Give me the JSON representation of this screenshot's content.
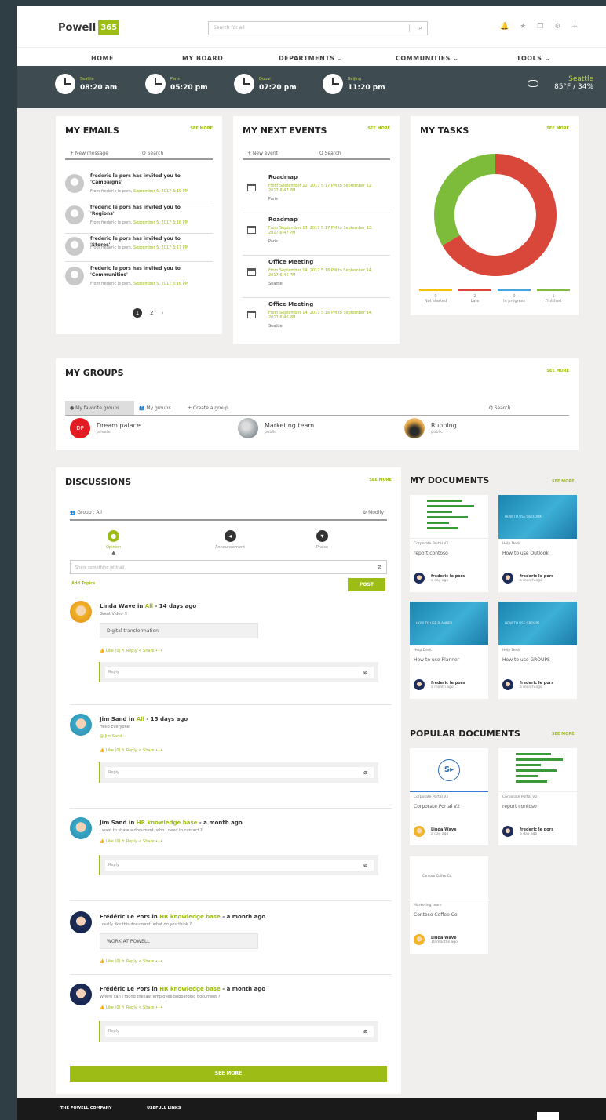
{
  "header": {
    "logo_text": "Powell",
    "logo_badge": "365",
    "search_placeholder": "Search for all",
    "icons": [
      "bell-icon",
      "star-icon",
      "copy-icon",
      "gear-icon",
      "plus-icon"
    ]
  },
  "nav": [
    "HOME",
    "MY BOARD",
    "DEPARTMENTS ⌄",
    "COMMUNITIES ⌄",
    "TOOLS ⌄"
  ],
  "clocks": [
    {
      "city": "Seattle",
      "time": "08:20 am"
    },
    {
      "city": "Paris",
      "time": "05:20 pm"
    },
    {
      "city": "Dubai",
      "time": "07:20 pm"
    },
    {
      "city": "Beijing",
      "time": "11:20 pm"
    }
  ],
  "weather": {
    "city": "Seattle",
    "temp": "85°F / 34%"
  },
  "emails": {
    "title": "MY EMAILS",
    "see_more": "SEE MORE",
    "new_label": "+ New message",
    "search_label": "Q  Search",
    "items": [
      {
        "subject": "frederic le pors has invited you to 'Campaigns'",
        "from": "From frederic le pors,",
        "date": "September 5, 2017 3:19 PM"
      },
      {
        "subject": "frederic le pors has invited you to 'Regions'",
        "from": "From frederic le pors,",
        "date": "September 5, 2017 3:18 PM"
      },
      {
        "subject": "frederic le pors has invited you to 'Stores'",
        "from": "From frederic le pors,",
        "date": "September 5, 2017 3:17 PM"
      },
      {
        "subject": "frederic le pors has invited you to 'Communities'",
        "from": "From frederic le pors,",
        "date": "September 5, 2017 3:16 PM"
      }
    ],
    "pages": [
      "1",
      "2",
      "›"
    ]
  },
  "events": {
    "title": "MY NEXT EVENTS",
    "see_more": "SEE MORE",
    "new_label": "+ New event",
    "search_label": "Q  Search",
    "items": [
      {
        "title": "Roadmap",
        "date": "From September 12, 2017 5:17 PM to September 12, 2017 6:47 PM",
        "location": "Paris"
      },
      {
        "title": "Roadmap",
        "date": "From September 13, 2017 5:17 PM to September 13, 2017 6:47 PM",
        "location": "Paris"
      },
      {
        "title": "Office Meeting",
        "date": "From September 14, 2017 5:16 PM to September 14, 2017 6:46 PM",
        "location": "Seattle"
      },
      {
        "title": "Office Meeting",
        "date": "From September 14, 2017 5:16 PM to September 14, 2017 6:46 PM",
        "location": "Seattle"
      }
    ]
  },
  "tasks": {
    "title": "MY TASKS",
    "see_more": "SEE MORE",
    "legend": [
      {
        "label": "Not started",
        "count": "0",
        "color": "#f2c200"
      },
      {
        "label": "Late",
        "count": "2",
        "color": "#d9463a"
      },
      {
        "label": "In progress",
        "count": "0",
        "color": "#3fa8e0"
      },
      {
        "label": "Finished",
        "count": "1",
        "color": "#7dbb3a"
      }
    ]
  },
  "groups": {
    "title": "MY GROUPS",
    "see_more": "SEE MORE",
    "tabs": [
      "● My favorite groups",
      "👥  My groups",
      "+  Create a group"
    ],
    "search_label": "Q  Search",
    "items": [
      {
        "name": "Dream palace",
        "privacy": "private",
        "initials": "DP",
        "color": "#e31b23"
      },
      {
        "name": "Marketing team",
        "privacy": "public",
        "initials": "",
        "color": "#9aa3a8"
      },
      {
        "name": "Running",
        "privacy": "public",
        "initials": "",
        "color": "#d9862a"
      }
    ]
  },
  "discussions": {
    "title": "DISCUSSIONS",
    "see_more": "SEE MORE",
    "group_label": "👥  Group : All",
    "modify_label": "⚙ Modify",
    "types": [
      {
        "label": "Opinion",
        "active": true
      },
      {
        "label": "Announcement",
        "active": false
      },
      {
        "label": "Praise",
        "active": false
      }
    ],
    "share_placeholder": "Share something with all",
    "add_topics": "Add Topics",
    "post_button": "POST",
    "posts": [
      {
        "author": "Linda Wave",
        "in_word": " in ",
        "group": "All",
        "ago": " - 14 days ago",
        "body": "Great Video !!",
        "quote": "Digital transformation",
        "actions": "👍 Like (0)    ↰ Reply    < Share    •••",
        "reply": "Reply"
      },
      {
        "author": "Jim Sand",
        "in_word": " in ",
        "group": "All",
        "ago": " - 15 days ago",
        "body": "Hello Everyone!",
        "quote": "",
        "mention": "@ Jim Sand",
        "actions": "👍 Like (0)    ↰ Reply    < Share    •••",
        "reply": "Reply"
      },
      {
        "author": "Jim Sand",
        "in_word": " in ",
        "group": "HR knowledge base",
        "ago": " - a month ago",
        "body": "I want to share a document, who I need to contact ?",
        "quote": "",
        "actions": "👍 Like (0)    ↰ Reply    < Share    •••",
        "reply": "Reply"
      },
      {
        "author": "Frédéric Le Pors",
        "in_word": " in ",
        "group": "HR knowledge base",
        "ago": " - a month ago",
        "body": "I really like this document, what do you think ?",
        "quote": "WORK AT POWELL",
        "actions": "👍 Like (0)    ↰ Reply    < Share    •••",
        "reply": ""
      },
      {
        "author": "Frédéric Le Pors",
        "in_word": " in ",
        "group": "HR knowledge base",
        "ago": " - a month ago",
        "body": "Where can I found the last employee onboarding document ?",
        "quote": "",
        "actions": "👍 Like (0)    ↰ Reply    < Share    •••",
        "reply": "Reply"
      }
    ],
    "see_more_button": "SEE MORE"
  },
  "my_documents": {
    "title": "MY DOCUMENTS",
    "see_more": "SEE MORE",
    "items": [
      {
        "library": "Corporate Portal V2",
        "name": "report contoso",
        "author": "frederic le pors",
        "ago": "a day ago",
        "thumb": "chart"
      },
      {
        "library": "Help Desk",
        "name": "How to use Outlook",
        "author": "frederic le pors",
        "ago": "a month ago",
        "thumb": "blue",
        "thumb_text": "HOW TO USE OUTLOOK"
      },
      {
        "library": "Help Desk",
        "name": "How to use Planner",
        "author": "frederic le pors",
        "ago": "a month ago",
        "thumb": "blue",
        "thumb_text": "HOW TO USE PLANNER"
      },
      {
        "library": "Help Desk",
        "name": "How to use GROUPS",
        "author": "frederic le pors",
        "ago": "a month ago",
        "thumb": "blue",
        "thumb_text": "HOW TO USE GROUPS"
      }
    ]
  },
  "popular_documents": {
    "title": "POPULAR DOCUMENTS",
    "see_more": "SEE MORE",
    "items": [
      {
        "library": "Corporate Portal V2",
        "name": "Corporate Portal V2",
        "author": "Linda Wave",
        "ago": "a day ago",
        "thumb": "sway"
      },
      {
        "library": "Corporate Portal V2",
        "name": "report contoso",
        "author": "frederic le pors",
        "ago": "a day ago",
        "thumb": "chart"
      },
      {
        "library": "Marketing team",
        "name": "Contoso Coffee Co.",
        "author": "Linda Wave",
        "ago": "10 months ago",
        "thumb": "doc",
        "thumb_text": "Contoso Coffee Co."
      }
    ]
  },
  "footer": {
    "col1": "THE POWELL COMPANY",
    "col2": "USEFULL LINKS"
  },
  "colors": {
    "accent": "#9dbd16",
    "clockbar": "#3e4c51",
    "late": "#d9463a",
    "finished": "#7dbb3a"
  }
}
